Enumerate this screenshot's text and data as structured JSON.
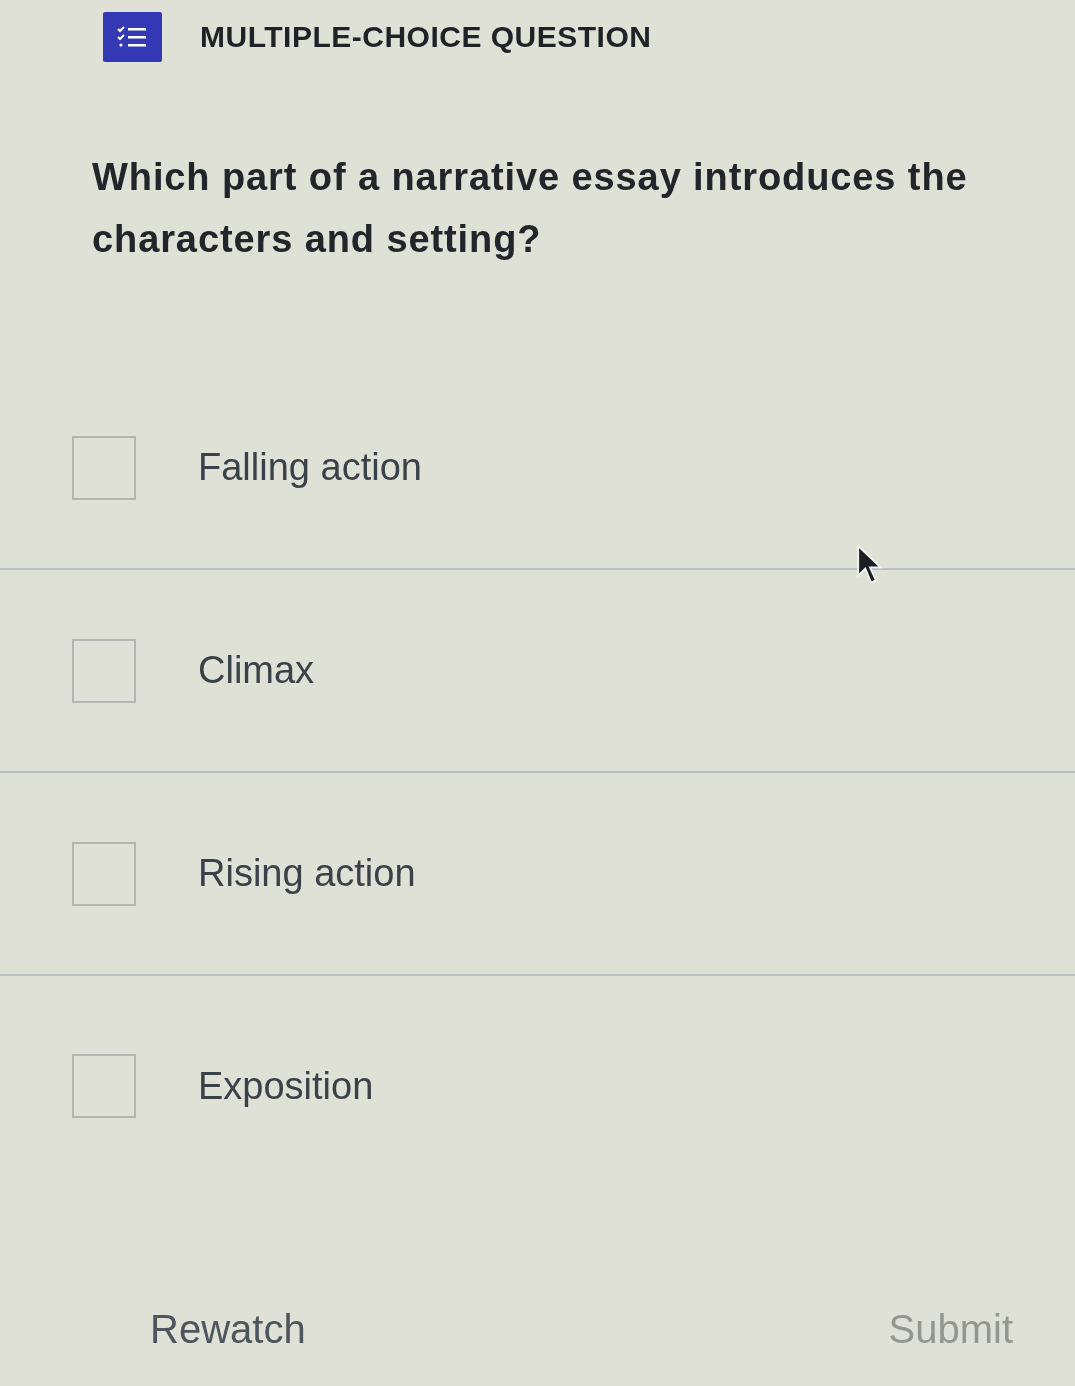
{
  "header": {
    "title": "MULTIPLE-CHOICE QUESTION"
  },
  "question": "Which part of a narrative essay introduces the characters and setting?",
  "options": [
    {
      "label": "Falling action",
      "checked": false
    },
    {
      "label": "Climax",
      "checked": false
    },
    {
      "label": "Rising action",
      "checked": false
    },
    {
      "label": "Exposition",
      "checked": false
    }
  ],
  "footer": {
    "rewatch": {
      "label": "Rewatch"
    },
    "submit": {
      "label": "Submit",
      "disabled": true
    }
  }
}
